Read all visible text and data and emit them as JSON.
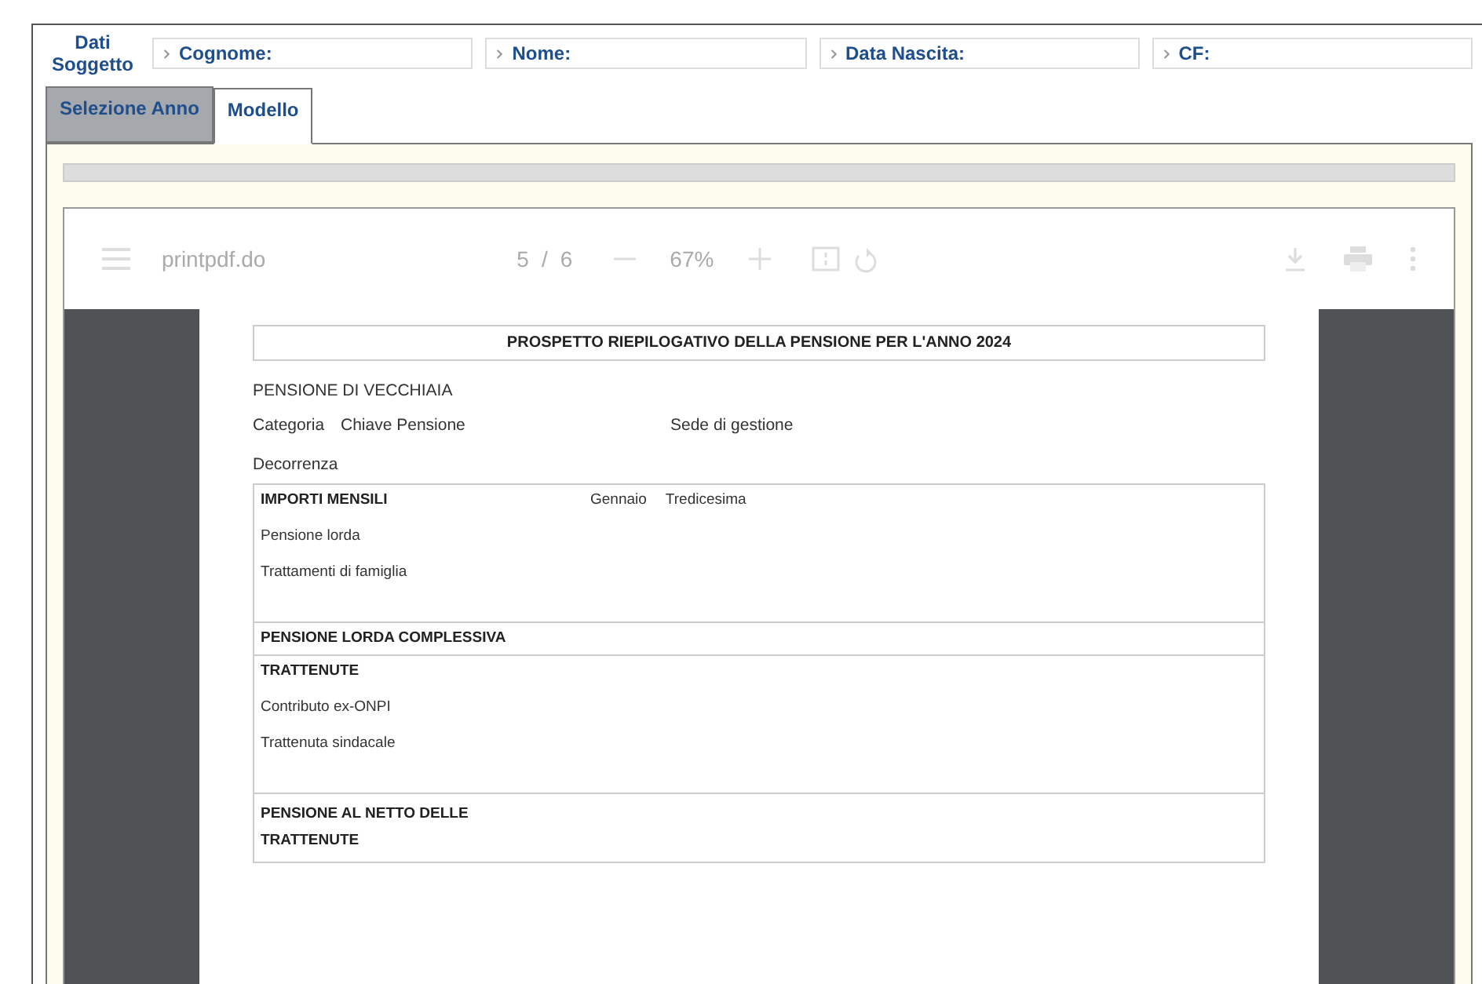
{
  "subject": {
    "label": "Dati Soggetto",
    "fields": [
      {
        "label": "Cognome:"
      },
      {
        "label": "Nome:"
      },
      {
        "label": "Data Nascita:"
      },
      {
        "label": "CF:"
      }
    ]
  },
  "tabs": [
    {
      "label": "Selezione Anno",
      "selected": false
    },
    {
      "label": "Modello",
      "selected": true
    }
  ],
  "viewer": {
    "filename": "printpdf.do",
    "page": "5",
    "separator": "/",
    "total": "6",
    "zoom": "67%"
  },
  "document": {
    "title": "PROSPETTO RIEPILOGATIVO DELLA PENSIONE PER L'ANNO 2024",
    "pension_type": "PENSIONE DI VECCHIAIA",
    "info_row": [
      "Categoria",
      "Chiave Pensione",
      "Sede di gestione"
    ],
    "start_label": "Decorrenza",
    "sections": [
      {
        "heading": "IMPORTI MENSILI",
        "columns": [
          "Gennaio",
          "Tredicesima"
        ],
        "rows": [
          "Pensione lorda",
          "Trattamenti di famiglia"
        ]
      },
      {
        "heading": "PENSIONE LORDA COMPLESSIVA"
      },
      {
        "heading": "TRATTENUTE",
        "rows": [
          "Contributo ex-ONPI",
          "Trattenuta sindacale"
        ]
      },
      {
        "heading": "PENSIONE AL NETTO DELLE TRATTENUTE"
      }
    ]
  }
}
